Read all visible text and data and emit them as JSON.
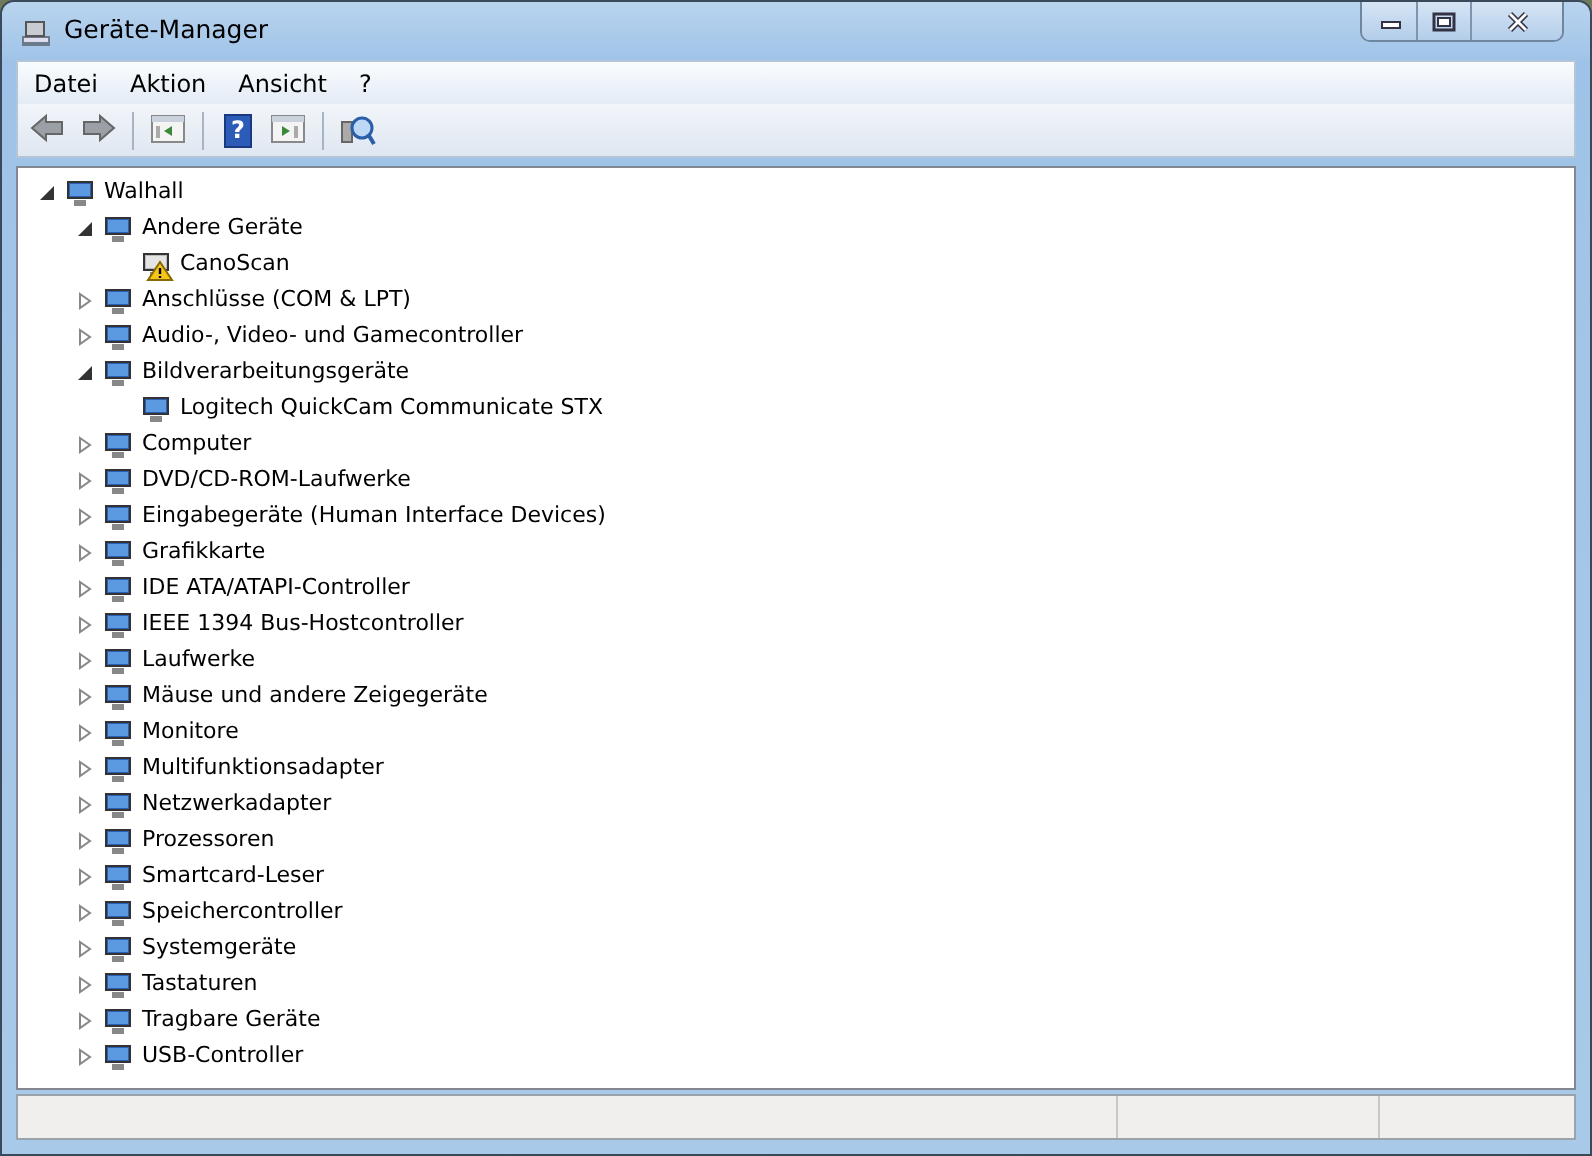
{
  "window": {
    "title": "Geräte-Manager"
  },
  "menu": [
    "Datei",
    "Aktion",
    "Ansicht",
    "?"
  ],
  "toolbar": [
    {
      "kind": "back"
    },
    {
      "kind": "forward"
    },
    {
      "kind": "sep"
    },
    {
      "kind": "pane"
    },
    {
      "kind": "sep"
    },
    {
      "kind": "help",
      "glyph": "?"
    },
    {
      "kind": "pane2"
    },
    {
      "kind": "sep"
    },
    {
      "kind": "scan"
    }
  ],
  "tree": [
    {
      "label": "Walhall",
      "expanded": true,
      "children": [
        {
          "label": "Andere Geräte",
          "expanded": true,
          "children": [
            {
              "label": "CanoScan",
              "warning": true
            }
          ]
        },
        {
          "label": "Anschlüsse (COM & LPT)",
          "expanded": false
        },
        {
          "label": "Audio-, Video- und Gamecontroller",
          "expanded": false
        },
        {
          "label": "Bildverarbeitungsgeräte",
          "expanded": true,
          "children": [
            {
              "label": "Logitech QuickCam Communicate STX",
              "warning": false
            }
          ]
        },
        {
          "label": "Computer",
          "expanded": false
        },
        {
          "label": "DVD/CD-ROM-Laufwerke",
          "expanded": false
        },
        {
          "label": "Eingabegeräte (Human Interface Devices)",
          "expanded": false
        },
        {
          "label": "Grafikkarte",
          "expanded": false
        },
        {
          "label": "IDE ATA/ATAPI-Controller",
          "expanded": false
        },
        {
          "label": "IEEE 1394 Bus-Hostcontroller",
          "expanded": false
        },
        {
          "label": "Laufwerke",
          "expanded": false
        },
        {
          "label": "Mäuse und andere Zeigegeräte",
          "expanded": false
        },
        {
          "label": "Monitore",
          "expanded": false
        },
        {
          "label": "Multifunktionsadapter",
          "expanded": false
        },
        {
          "label": "Netzwerkadapter",
          "expanded": false
        },
        {
          "label": "Prozessoren",
          "expanded": false
        },
        {
          "label": "Smartcard-Leser",
          "expanded": false
        },
        {
          "label": "Speichercontroller",
          "expanded": false
        },
        {
          "label": "Systemgeräte",
          "expanded": false
        },
        {
          "label": "Tastaturen",
          "expanded": false
        },
        {
          "label": "Tragbare Geräte",
          "expanded": false
        },
        {
          "label": "USB-Controller",
          "expanded": false
        }
      ]
    }
  ]
}
